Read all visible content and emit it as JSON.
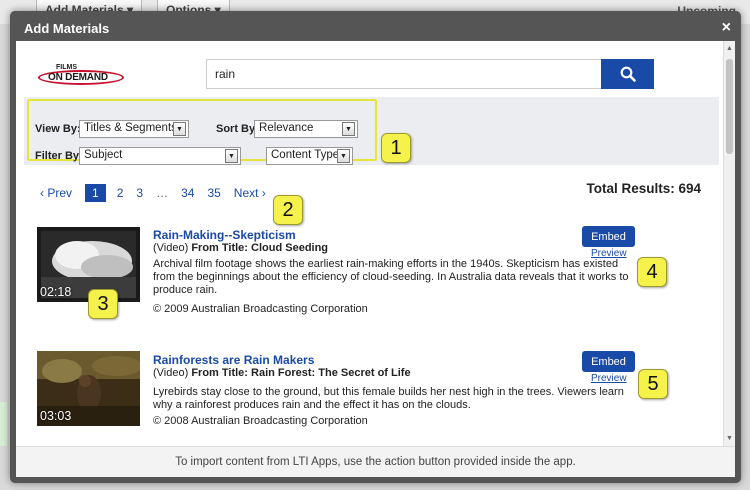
{
  "background": {
    "add_materials": "Add Materials ▾",
    "options": "Options ▾",
    "upcoming": "Upcoming"
  },
  "modal": {
    "title": "Add Materials",
    "close_glyph": "×"
  },
  "logo": {
    "top": "FILMS",
    "main": "ON DEMAND"
  },
  "search": {
    "value": "rain"
  },
  "filters": {
    "view_by_label": "View By:",
    "view_by_value": "Titles & Segments",
    "sort_by_label": "Sort By:",
    "sort_by_value": "Relevance",
    "filter_by_label": "Filter By:",
    "filter_by_value": "Subject",
    "content_type_value": "Content Type",
    "arrow_glyph": "▼"
  },
  "pagination": {
    "prev": "‹ Prev",
    "pages": [
      "1",
      "2",
      "3"
    ],
    "ellipsis": "…",
    "pages_end": [
      "34",
      "35"
    ],
    "next": "Next ›",
    "current": "1"
  },
  "total_results": "Total Results: 694",
  "results": [
    {
      "title": "Rain-Making--Skepticism",
      "type": "(Video)",
      "from_label": "From Title:",
      "from_title": "Cloud Seeding",
      "description": "Archival film footage shows the earliest rain-making efforts in the 1940s. Skepticism has existed from the beginnings about the efficiency of cloud-seeding. In Australia data reveals that it works to produce rain.",
      "copyright": "© 2009  Australian Broadcasting Corporation",
      "duration": "02:18",
      "embed_label": "Embed",
      "preview_label": "Preview"
    },
    {
      "title": "Rainforests are Rain Makers",
      "type": "(Video)",
      "from_label": "From Title:",
      "from_title": "Rain Forest: The Secret of Life",
      "description": "Lyrebirds stay close to the ground, but this female builds her nest high in the trees. Viewers learn why a rainforest produces rain and the effect it has on the clouds.",
      "copyright": "© 2008  Australian Broadcasting Corporation",
      "duration": "03:03",
      "embed_label": "Embed",
      "preview_label": "Preview"
    }
  ],
  "callouts": [
    "1",
    "2",
    "3",
    "4",
    "5"
  ],
  "footer": {
    "text": "To import content from LTI Apps, use the action button provided inside the app."
  },
  "colors": {
    "accent": "#1a4aa8",
    "callout": "#f6f24c",
    "modal_frame": "#555555"
  }
}
